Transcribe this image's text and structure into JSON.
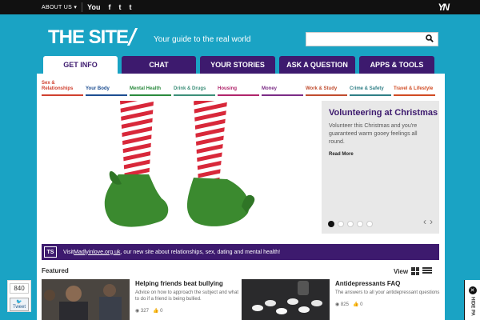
{
  "topbar": {
    "about": "ABOUT US",
    "caret": "▾",
    "youtube": "You",
    "facebook": "f",
    "twitter": "t",
    "tumblr": "t",
    "network_logo": "YN"
  },
  "header": {
    "logo": "THE SITE",
    "tagline": "Your guide to the real world",
    "search_placeholder": "",
    "search_icon": "search-icon"
  },
  "tabs": [
    {
      "label": "GET INFO",
      "active": true
    },
    {
      "label": "CHAT",
      "active": false
    },
    {
      "label": "YOUR STORIES",
      "active": false
    },
    {
      "label": "ASK A QUESTION",
      "active": false
    },
    {
      "label": "APPS & TOOLS",
      "active": false
    }
  ],
  "subnav": [
    {
      "label": "Sex & Relationships",
      "color": "#d0402f"
    },
    {
      "label": "Your Body",
      "color": "#1d4e91"
    },
    {
      "label": "Mental Health",
      "color": "#2b8a3e"
    },
    {
      "label": "Drink & Drugs",
      "color": "#3d8f79"
    },
    {
      "label": "Housing",
      "color": "#b0256b"
    },
    {
      "label": "Money",
      "color": "#7b2c86"
    },
    {
      "label": "Work & Study",
      "color": "#c04c2e"
    },
    {
      "label": "Crime & Safety",
      "color": "#2f7f86"
    },
    {
      "label": "Travel & Lifestyle",
      "color": "#d14b23"
    }
  ],
  "feature": {
    "title": "Volunteering at Christmas",
    "body": "Volunteer this Christmas and you're guaranteed warm gooey feelings all round.",
    "more": "Read More",
    "slide_count": 5,
    "active_slide": 0
  },
  "banner": {
    "badge": "TS",
    "prefix": "Visit ",
    "link": "Madlyinlove.org.uk",
    "suffix": ", our new site about relationships, sex, dating and mental health!"
  },
  "section": {
    "featured": "Featured",
    "view": "View"
  },
  "cards": [
    {
      "title": "Helping friends beat bullying",
      "desc": "Advice on how to approach the subject and what to do if a friend is being bullied.",
      "views": "327",
      "likes": "0"
    },
    {
      "title": "Antidepressants FAQ",
      "desc": "The answers to all your antidepressant questions",
      "views": "825",
      "likes": "0"
    }
  ],
  "share": {
    "count": "840",
    "tweet": "Tweet"
  },
  "hide_panel": {
    "close": "✕",
    "label": "HIDE PA"
  },
  "colors": {
    "brand_blue": "#1aa3c4",
    "brand_purple": "#3d1a6e"
  }
}
